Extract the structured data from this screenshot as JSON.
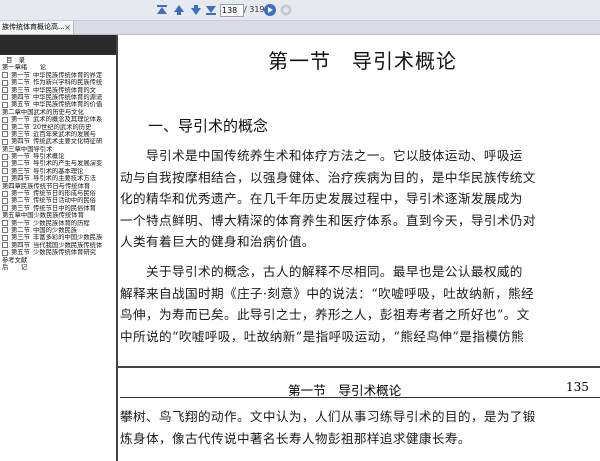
{
  "toolbar": {
    "current_page": "138",
    "total_pages": "/ 319"
  },
  "tab": {
    "title": "族传统体育概论高...",
    "close": "×"
  },
  "toc": [
    {
      "t": "title",
      "text": "目　录"
    },
    {
      "t": "chapter",
      "text": "第一章绪　　论"
    },
    {
      "t": "item",
      "num": "第一节",
      "text": "中华民族传统体育的界定"
    },
    {
      "t": "item",
      "num": "第二节",
      "text": "作为新兴学科的民族传统"
    },
    {
      "t": "item",
      "num": "第三节",
      "text": "中华民族传统体育的文"
    },
    {
      "t": "item",
      "num": "第四节",
      "text": "中华民族传统体育的源流"
    },
    {
      "t": "item",
      "num": "第五节",
      "text": "中华民族传统体育的价值"
    },
    {
      "t": "chapter",
      "text": "第二章中国武术的历史与文化"
    },
    {
      "t": "item",
      "num": "第一节",
      "text": "武术的概念及其理论体系"
    },
    {
      "t": "item",
      "num": "第二节",
      "text": "20世纪的武术的历史"
    },
    {
      "t": "item",
      "num": "第三节",
      "text": "近百年来武术的发展与"
    },
    {
      "t": "item",
      "num": "第四节",
      "text": "传统武术主要文化特征研"
    },
    {
      "t": "chapter",
      "text": "第三章中国导引术"
    },
    {
      "t": "item",
      "num": "第一节",
      "text": "导引术概论"
    },
    {
      "t": "item",
      "num": "第二节",
      "text": "导引术的产生与发展演变"
    },
    {
      "t": "item",
      "num": "第三节",
      "text": "导引术的基本理论"
    },
    {
      "t": "item",
      "num": "第四节",
      "text": "导引术的主要技术方法"
    },
    {
      "t": "chapter",
      "text": "第四章民族传统节日与传统体育"
    },
    {
      "t": "item",
      "num": "第一节",
      "text": "传统节日的形成与民俗"
    },
    {
      "t": "item",
      "num": "第二节",
      "text": "传统节日活动中的民俗"
    },
    {
      "t": "item",
      "num": "第三节",
      "text": "传统节日中的民俗体育"
    },
    {
      "t": "chapter",
      "text": "第五章中国少数民族传统体育"
    },
    {
      "t": "item",
      "num": "第一节",
      "text": "少数民族体育的历程"
    },
    {
      "t": "item",
      "num": "第二节",
      "text": "中国的少数民族"
    },
    {
      "t": "item",
      "num": "第三节",
      "text": "丰富多彩的中国少数民族"
    },
    {
      "t": "item",
      "num": "第四节",
      "text": "当代我国少数民族传统体"
    },
    {
      "t": "item",
      "num": "第五节",
      "text": "少数民族传统体育研究"
    },
    {
      "t": "plain",
      "text": "参考文献"
    },
    {
      "t": "plain",
      "text": "后　　记"
    }
  ],
  "doc": {
    "section_title": "第一节　导引术概论",
    "heading": "一、导引术的概念",
    "para1": [
      "　　导引术是中国传统养生术和体疗方法之一。它以肢体运动、呼吸运",
      "动与自我按摩相结合，以强身健体、治疗疾病为目的，是中华民族传统文",
      "化的精华和优秀遗产。在几千年历史发展过程中，导引术逐渐发展成为",
      "一个特点鲜明、博大精深的体育养生和医疗体系。直到今天，导引术仍对",
      "人类有着巨大的健身和治病价值。"
    ],
    "para2": [
      "　　关于导引术的概念，古人的解释不尽相同。最早也是公认最权威的",
      "解释来自战国时期《庄子·刻意》中的说法：“吹嘘呼吸，吐故纳新，熊经",
      "鸟伸，为寿而已矣。此导引之士，养形之人，彭祖寿考者之所好也”。文",
      "中所说的“吹嘘呼吸，吐故纳新”是指呼吸运动，“熊经鸟伸”是指模仿熊"
    ],
    "running_header": "第一节　导引术概论",
    "page_number": "135",
    "para3": [
      "攀树、鸟飞翔的动作。文中认为，人们从事习练导引术的目的，是为了锻",
      "炼身体，像古代传说中著名长寿人物彭祖那样追求健康长寿。"
    ]
  }
}
